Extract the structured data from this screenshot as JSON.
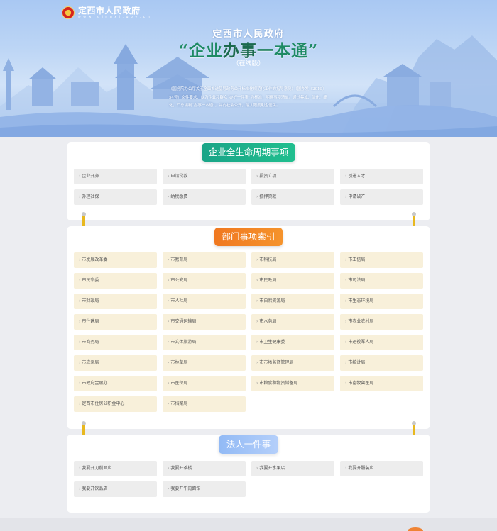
{
  "header": {
    "site_name": "定西市人民政府",
    "site_url": "w w w . d i n g x i . g o v . c n",
    "gov_title": "定西市人民政府",
    "slogan": {
      "open_quote": "“",
      "part1": "企业",
      "part2": "办事",
      "dash": "一",
      "part3": "本通",
      "close_quote": "”"
    },
    "online_tag": "（在线版）",
    "intro": "《国务院办公厅关于全面推进基层政务公开标准化规范化工作的指导意见》（国办发〔2019〕54号）文件要求：以为企业和群众“办好一件事”为标准，明确事项清单。通过集成、优化、简化，汇总编制“办事一本通”，并向社会公开，最大限度利企便民。"
  },
  "sections": [
    {
      "title": "企业全生命周期事项",
      "items": [
        "企业开办",
        "申请贷款",
        "投资立项",
        "引进人才",
        "办理社保",
        "纳税缴费",
        "抵押貸款",
        "申请破产"
      ]
    },
    {
      "title": "部门事项索引",
      "items": [
        "市发展改革委",
        "市教育局",
        "市科技局",
        "市工信局",
        "市民宗委",
        "市公安局",
        "市民政局",
        "市司法局",
        "市财政局",
        "市人社局",
        "市自然资源局",
        "市生态环境局",
        "市住建局",
        "市交通运输局",
        "市水务局",
        "市农业农村局",
        "市商务局",
        "市文体旅游局",
        "市卫生健康委",
        "市退役军人局",
        "市应急局",
        "市林草局",
        "市市场监督管理局",
        "市统计局",
        "市政府金融办",
        "市医保局",
        "市粮食和物资储备局",
        "市畜牧兽医局",
        "定西市住房公积金中心",
        "市档案局"
      ]
    },
    {
      "title": "法人一件事",
      "items": [
        "我要开刀削面店",
        "我要开茶楼",
        "我要开水果店",
        "我要开服装店",
        "我要开饮品店",
        "我要开牛肉面馆"
      ]
    }
  ],
  "colors": {
    "section1_title_bg": "#19a487",
    "section2_title_bg": "#f07820",
    "section3_title_bg": "#92baf5",
    "item_gray": "#ededed",
    "item_yellow": "#f8f0da",
    "connector": "#e8b81f"
  },
  "icons": {
    "item_arrow": "chevron-right-icon",
    "logo": "national-emblem-icon"
  }
}
